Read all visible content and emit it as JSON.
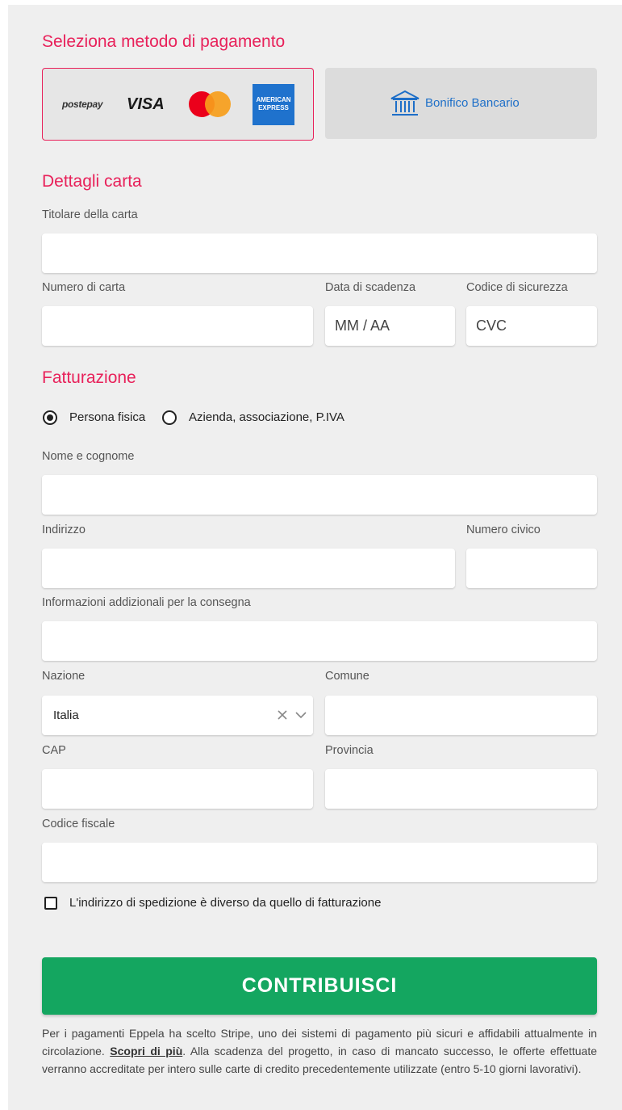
{
  "payment_method": {
    "title": "Seleziona metodo di pagamento",
    "card_option": {
      "logos": {
        "postepay": "postepay",
        "visa": "VISA",
        "amex": [
          "AMERICAN",
          "EXPRESS"
        ]
      }
    },
    "bank_option": {
      "label": "Bonifico Bancario",
      "icon": "bank-icon"
    }
  },
  "card_details": {
    "title": "Dettagli carta",
    "holder_label": "Titolare della carta",
    "holder_value": "",
    "number_label": "Numero di carta",
    "number_value": "",
    "expiry_label": "Data di scadenza",
    "expiry_placeholder": "MM / AA",
    "cvc_label": "Codice di sicurezza",
    "cvc_placeholder": "CVC"
  },
  "billing": {
    "title": "Fatturazione",
    "radio_person": "Persona fisica",
    "radio_company": "Azienda, associazione, P.IVA",
    "selected": "Persona fisica",
    "name_label": "Nome e cognome",
    "address_label": "Indirizzo",
    "civic_label": "Numero civico",
    "additional_label": "Informazioni addizionali per la consegna",
    "country_label": "Nazione",
    "country_value": "Italia",
    "city_label": "Comune",
    "cap_label": "CAP",
    "province_label": "Provincia",
    "fiscal_label": "Codice fiscale",
    "shipping_checkbox": "L'indirizzo di spedizione è diverso da quello di fatturazione"
  },
  "submit_label": "CONTRIBUISCI",
  "disclaimer": {
    "before_link": "Per i pagamenti Eppela ha scelto Stripe, uno dei sistemi di pagamento più sicuri e affidabili attualmente in circolazione. ",
    "link": "Scopri di più",
    "after_link": ". Alla scadenza del progetto, in caso di mancato successo, le offerte effettuate verranno accreditate per intero sulle carte di credito precedentemente utilizzate (entro 5-10 giorni lavorativi)."
  },
  "colors": {
    "accent": "#e8215a",
    "submit": "#14a660",
    "bank_blue": "#1e6fc8",
    "amex_blue": "#1f72cd",
    "mastercard_red": "#eb001b",
    "mastercard_orange": "#f79e1b"
  }
}
